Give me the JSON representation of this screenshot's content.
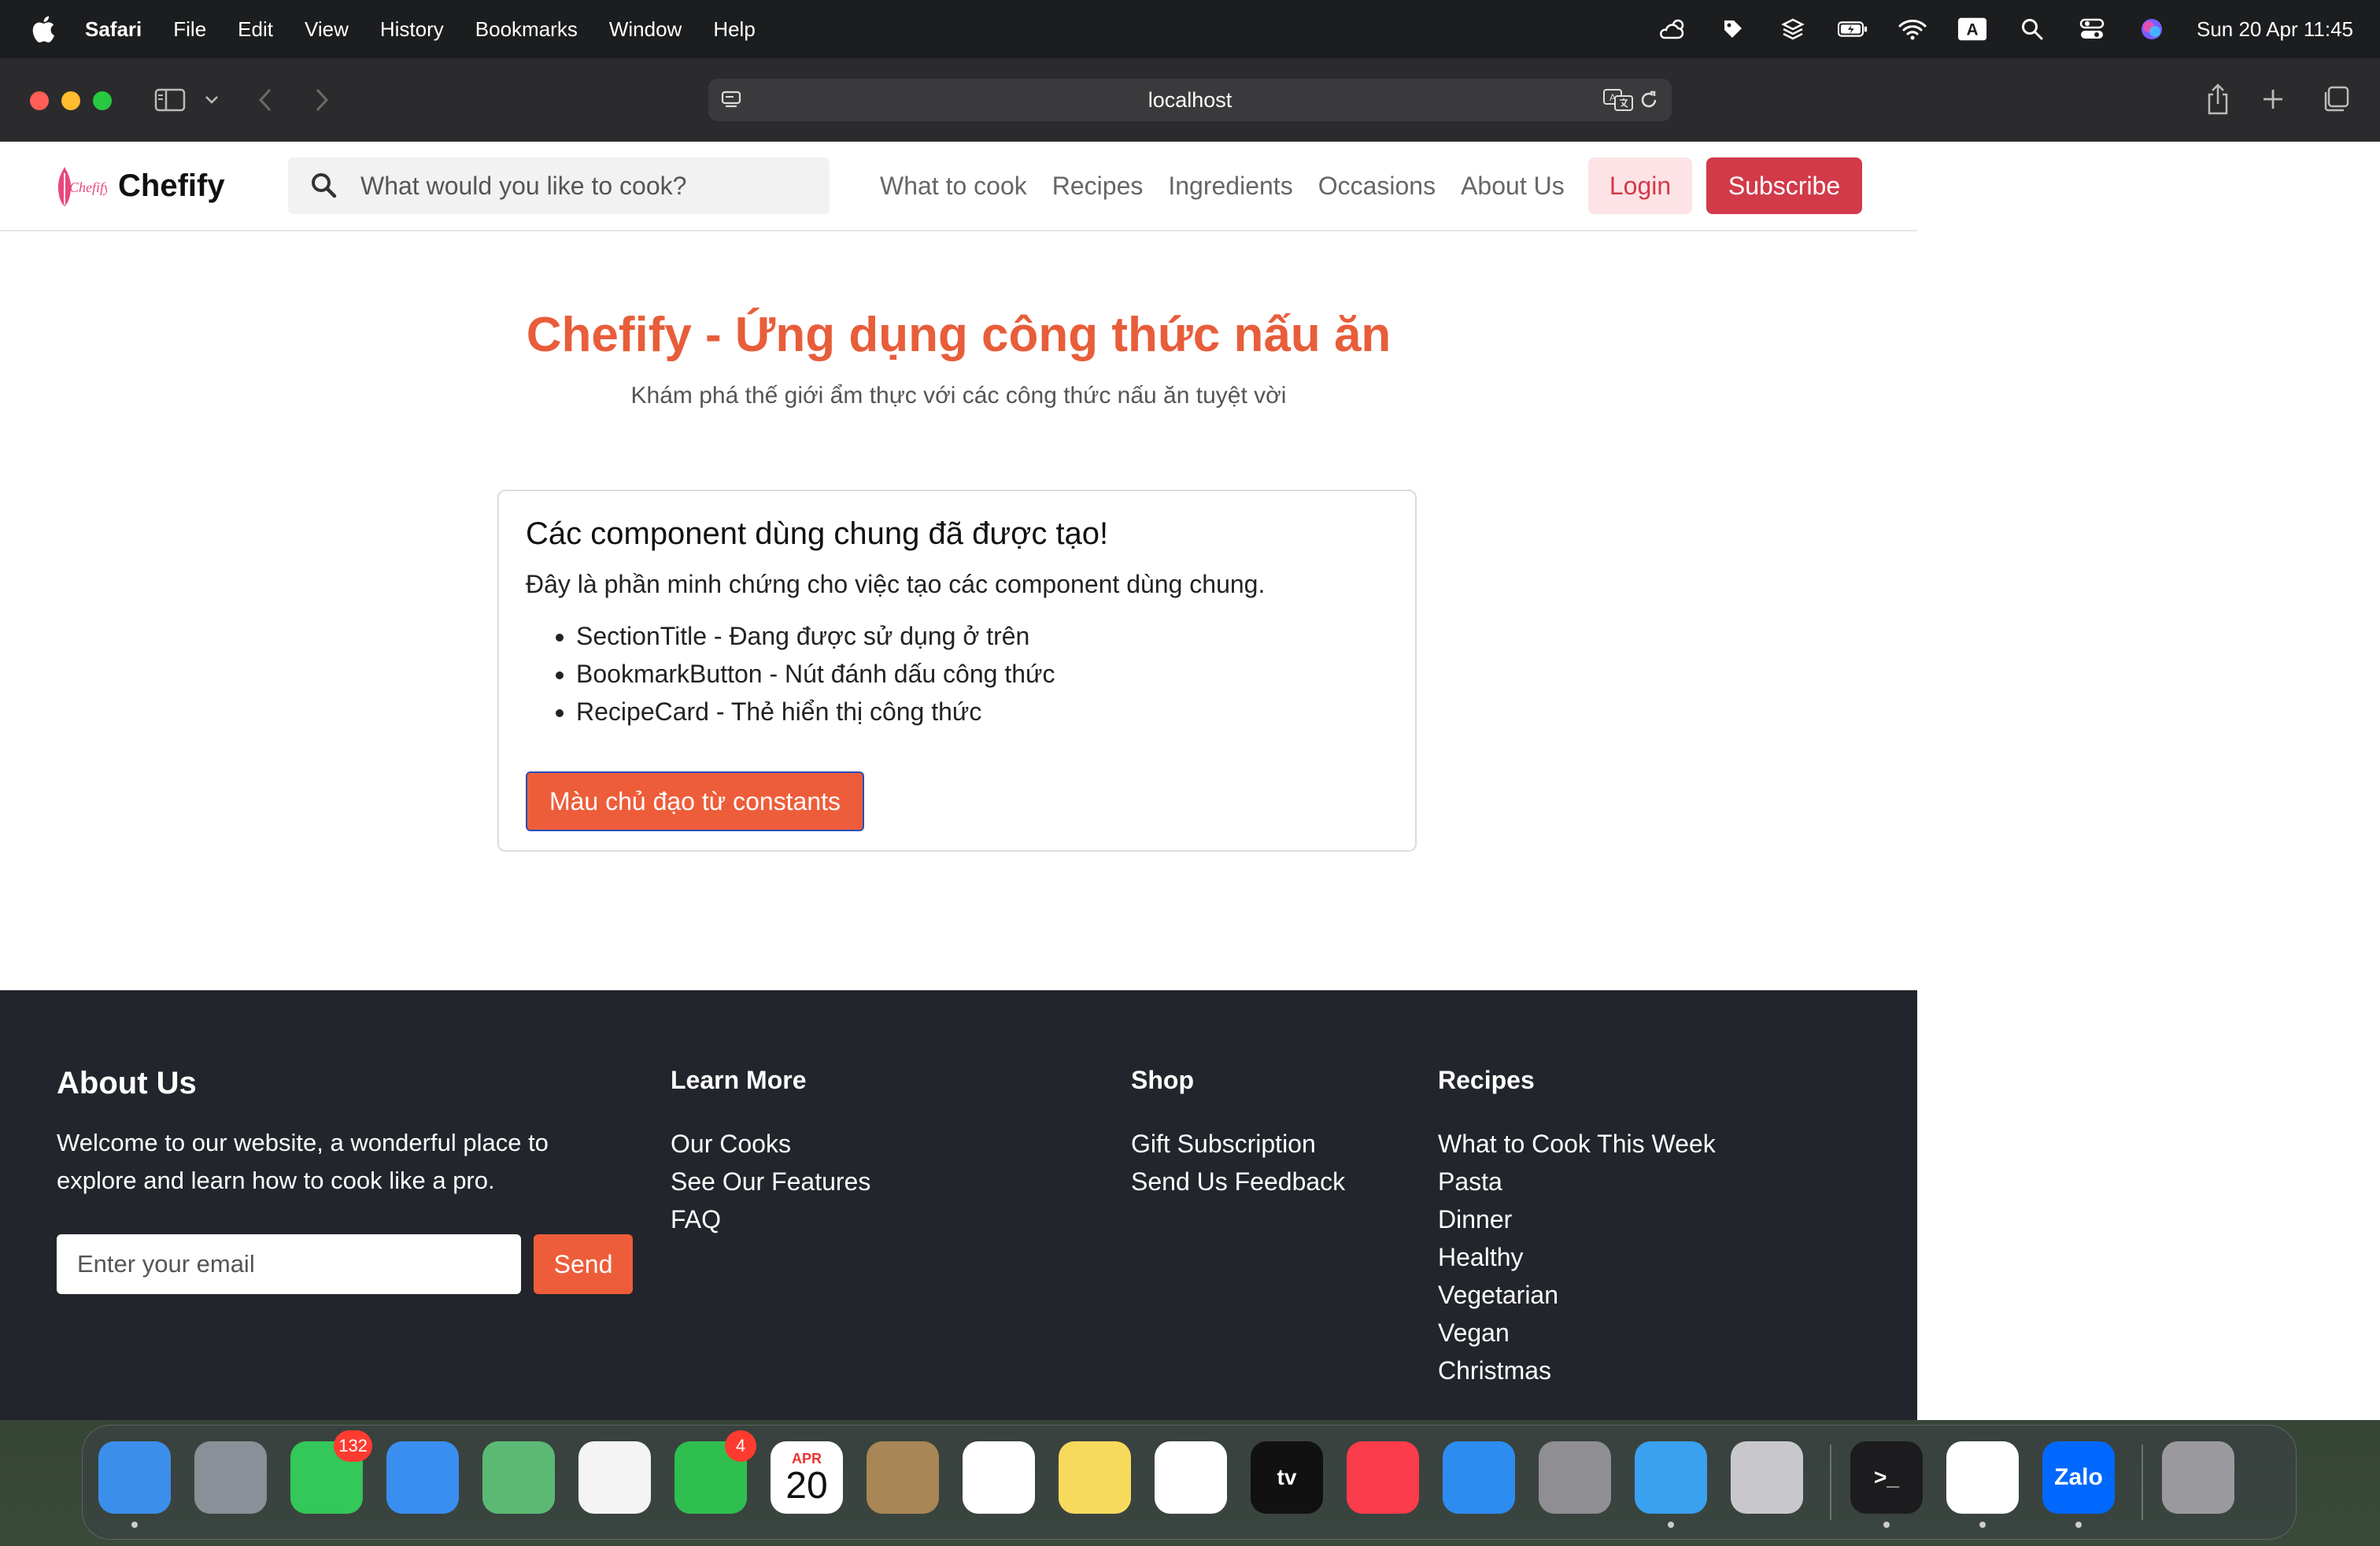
{
  "menubar": {
    "app": "Safari",
    "items": [
      "File",
      "Edit",
      "View",
      "History",
      "Bookmarks",
      "Window",
      "Help"
    ],
    "status_icons": [
      "cloud-sun-icon",
      "tag-icon",
      "layers-icon",
      "battery-icon",
      "wifi-icon",
      "keyboard-input-icon",
      "search-icon",
      "control-center-icon",
      "siri-icon"
    ],
    "input_source": "A",
    "clock": "Sun 20 Apr  11:45"
  },
  "browser": {
    "url": "localhost"
  },
  "site": {
    "brand": "Chefify",
    "search_placeholder": "What would you like to cook?",
    "nav": [
      "What to cook",
      "Recipes",
      "Ingredients",
      "Occasions",
      "About Us"
    ],
    "login": "Login",
    "subscribe": "Subscribe",
    "accent": "#e85d3a",
    "brand_red": "#d23a4a"
  },
  "hero": {
    "title": "Chefify - Ứng dụng công thức nấu ăn",
    "subtitle": "Khám phá thế giới ẩm thực với các công thức nấu ăn tuyệt vời"
  },
  "card": {
    "title": "Các component dùng chung đã được tạo!",
    "text": "Đây là phần minh chứng cho việc tạo các component dùng chung.",
    "items": [
      "SectionTitle - Đang được sử dụng ở trên",
      "BookmarkButton - Nút đánh dấu công thức",
      "RecipeCard - Thẻ hiển thị công thức"
    ],
    "button": "Màu chủ đạo từ constants"
  },
  "footer": {
    "about_title": "About Us",
    "about_text": "Welcome to our website, a wonderful place to explore and learn how to cook like a pro.",
    "email_placeholder": "Enter your email",
    "send": "Send",
    "columns": [
      {
        "title": "Learn More",
        "links": [
          "Our Cooks",
          "See Our Features",
          "FAQ"
        ]
      },
      {
        "title": "Shop",
        "links": [
          "Gift Subscription",
          "Send Us Feedback"
        ]
      },
      {
        "title": "Recipes",
        "links": [
          "What to Cook This Week",
          "Pasta",
          "Dinner",
          "Healthy",
          "Vegetarian",
          "Vegan",
          "Christmas"
        ]
      }
    ]
  },
  "dock": {
    "apps": [
      {
        "name": "finder-icon",
        "color": "#3b8eea"
      },
      {
        "name": "launchpad-icon",
        "color": "#8a8f98"
      },
      {
        "name": "messages-icon",
        "color": "#34c759",
        "badge": "132"
      },
      {
        "name": "mail-icon",
        "color": "#3a8ef0"
      },
      {
        "name": "maps-icon",
        "color": "#5bb974"
      },
      {
        "name": "photos-icon",
        "color": "#f4f4f4"
      },
      {
        "name": "facetime-icon",
        "color": "#2fbf4f",
        "badge": "4"
      },
      {
        "name": "calendar-icon",
        "color": "#ffffff",
        "month": "APR",
        "day": "20"
      },
      {
        "name": "contacts-icon",
        "color": "#a88655"
      },
      {
        "name": "reminders-icon",
        "color": "#ffffff"
      },
      {
        "name": "notes-icon",
        "color": "#f7d95c"
      },
      {
        "name": "freeform-icon",
        "color": "#ffffff"
      },
      {
        "name": "tv-icon",
        "color": "#111111",
        "label": "tv"
      },
      {
        "name": "music-icon",
        "color": "#fa3c4c"
      },
      {
        "name": "app-store-icon",
        "color": "#2d8cf0"
      },
      {
        "name": "system-settings-icon",
        "color": "#8e8e93"
      },
      {
        "name": "safari-icon",
        "color": "#3aa0f0"
      },
      {
        "name": "iphone-mirroring-icon",
        "color": "#c8c8cc"
      },
      {
        "name": "terminal-icon",
        "color": "#1c1c1e",
        "label": ">_"
      },
      {
        "name": "vscode-icon",
        "color": "#ffffff"
      },
      {
        "name": "zalo-icon",
        "color": "#0068ff",
        "label": "Zalo"
      },
      {
        "name": "trash-icon",
        "color": "#9a9a9e"
      }
    ]
  }
}
